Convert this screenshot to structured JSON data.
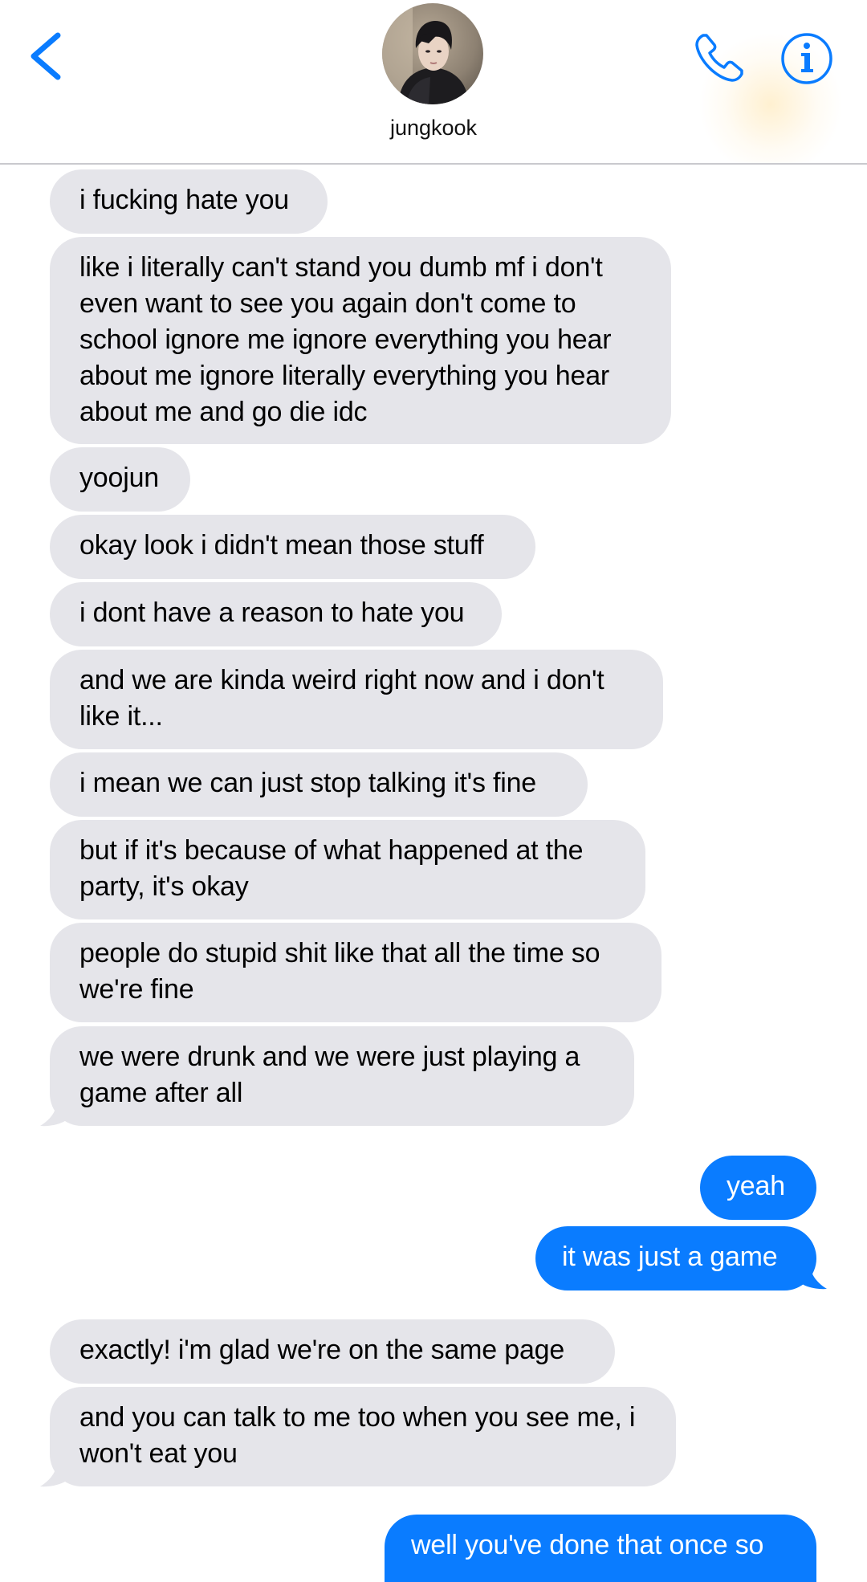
{
  "header": {
    "contact_name": "jungkook",
    "back_icon": "chevron-left-icon",
    "call_icon": "phone-icon",
    "info_icon": "info-icon",
    "accent_color": "#0a7cff"
  },
  "messages": [
    {
      "sender": "contact",
      "text": "i fucking hate you"
    },
    {
      "sender": "contact",
      "text": "like i literally can't stand you dumb mf i don't even want to see you again don't come to school ignore me ignore everything you hear about me ignore literally everything you hear about me and go die idc"
    },
    {
      "sender": "contact",
      "text": "yoojun"
    },
    {
      "sender": "contact",
      "text": "okay look i didn't mean those stuff"
    },
    {
      "sender": "contact",
      "text": "i dont have a reason to hate you"
    },
    {
      "sender": "contact",
      "text": "and we are kinda weird right now and i don't like it..."
    },
    {
      "sender": "contact",
      "text": "i mean we can just stop talking it's fine"
    },
    {
      "sender": "contact",
      "text": "but if it's because of what happened at the party, it's okay"
    },
    {
      "sender": "contact",
      "text": "people do stupid shit like that all the time so we're fine"
    },
    {
      "sender": "contact",
      "text": "we were drunk and we were just playing a game after all"
    },
    {
      "sender": "me",
      "text": "yeah"
    },
    {
      "sender": "me",
      "text": "it was just a game"
    },
    {
      "sender": "contact",
      "text": "exactly! i'm glad we're on the same page"
    },
    {
      "sender": "contact",
      "text": "and you can talk to me too when you see me, i won't eat you"
    },
    {
      "sender": "me",
      "text": "well you've done that once so"
    }
  ],
  "colors": {
    "incoming_bubble": "#e5e5ea",
    "outgoing_bubble": "#0a7cff",
    "incoming_text": "#000000",
    "outgoing_text": "#ffffff"
  }
}
